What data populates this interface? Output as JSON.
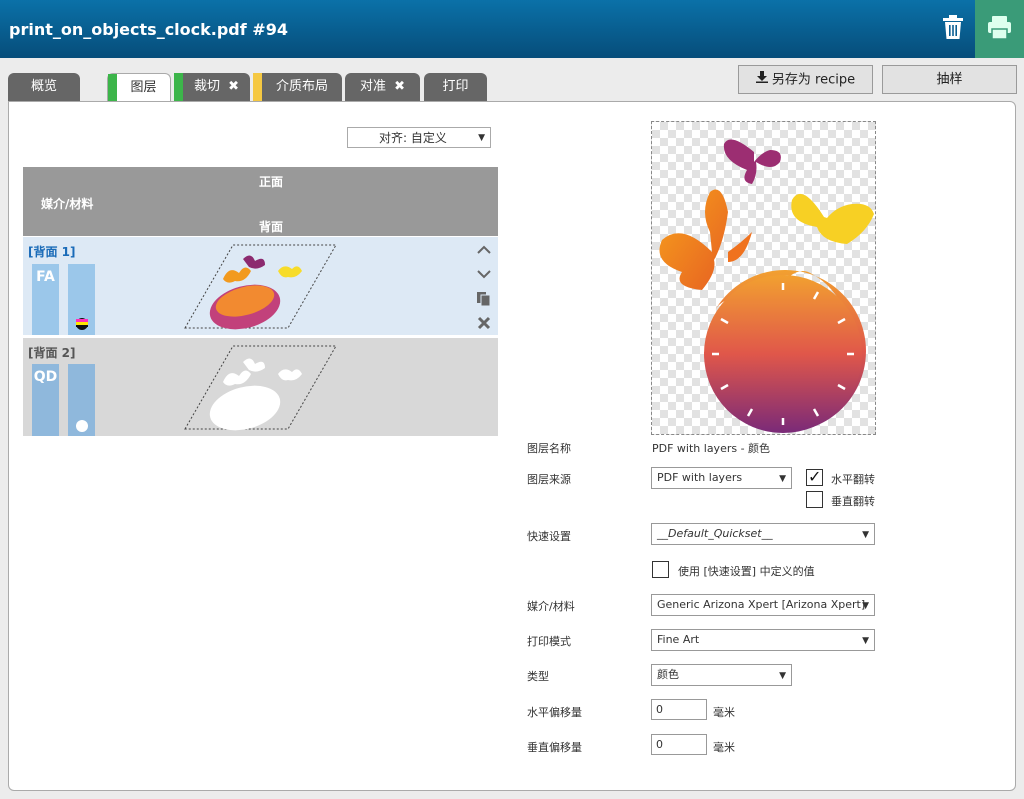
{
  "header": {
    "title": "print_on_objects_clock.pdf #94"
  },
  "tabs": [
    {
      "label": "概览"
    },
    {
      "label": "图层"
    },
    {
      "label": "裁切",
      "x": "✖"
    },
    {
      "label": "介质布局"
    },
    {
      "label": "对准",
      "x": "✖"
    },
    {
      "label": "打印"
    }
  ],
  "toolbar": {
    "save_recipe": "另存为 recipe",
    "sample": "抽样"
  },
  "align": {
    "label": "对齐: 自定义"
  },
  "layers": {
    "header": {
      "front": "正面",
      "media": "媒介/材料",
      "back": "背面"
    },
    "rows": [
      {
        "label": "[背面 1]",
        "code": "FA"
      },
      {
        "label": "[背面 2]",
        "code": "QD"
      }
    ]
  },
  "form": {
    "layer_name": {
      "label": "图层名称",
      "value": "PDF with layers - 颜色"
    },
    "layer_source": {
      "label": "图层来源",
      "value": "PDF with layers"
    },
    "flip_h": {
      "label": "水平翻转",
      "checked": "✓"
    },
    "flip_v": {
      "label": "垂直翻转"
    },
    "quickset": {
      "label": "快速设置",
      "value": "__Default_Quickset__"
    },
    "use_quickset": {
      "label": "使用 [快速设置] 中定义的值"
    },
    "media": {
      "label": "媒介/材料",
      "value": "Generic Arizona Xpert [Arizona Xpert]"
    },
    "print_mode": {
      "label": "打印模式",
      "value": "Fine Art"
    },
    "type": {
      "label": "类型",
      "value": "颜色"
    },
    "h_offset": {
      "label": "水平偏移量",
      "value": "0",
      "unit": "毫米"
    },
    "v_offset": {
      "label": "垂直偏移量",
      "value": "0",
      "unit": "毫米"
    }
  }
}
